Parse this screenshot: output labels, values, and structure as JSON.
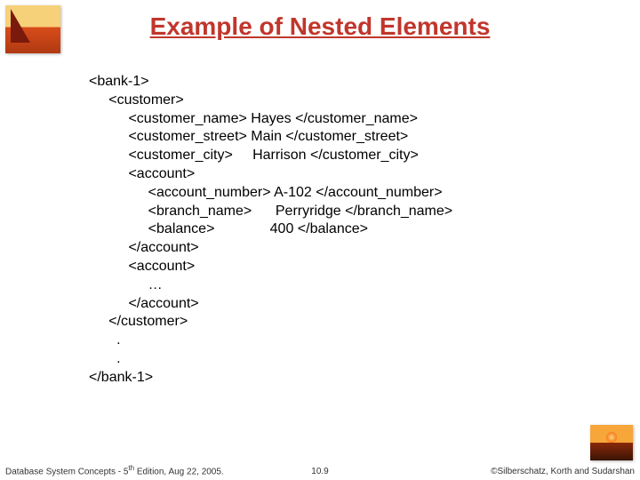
{
  "title": "Example of Nested Elements",
  "code": {
    "l01": "<bank-1>",
    "l02": "     <customer>",
    "l03": "          <customer_name> Hayes </customer_name>",
    "l04": "          <customer_street> Main </customer_street>",
    "l05": "          <customer_city>     Harrison </customer_city>",
    "l06": "          <account>",
    "l07": "               <account_number> A-102 </account_number>",
    "l08": "               <branch_name>      Perryridge </branch_name>",
    "l09": "               <balance>              400 </balance>",
    "l10": "          </account>",
    "l11": "          <account>",
    "l12": "               …",
    "l13": "          </account>",
    "l14": "     </customer>",
    "l15": "       .",
    "l16": "       .",
    "l17": "</bank-1>"
  },
  "footer": {
    "left_prefix": "Database System Concepts - 5",
    "left_suffix": " Edition, Aug 22, 2005.",
    "left_sup": "th",
    "center": "10.9",
    "right": "©Silberschatz, Korth and Sudarshan"
  },
  "icons": {
    "top_left": "sailboat-sunset-image",
    "bottom_right": "sunset-water-image"
  }
}
